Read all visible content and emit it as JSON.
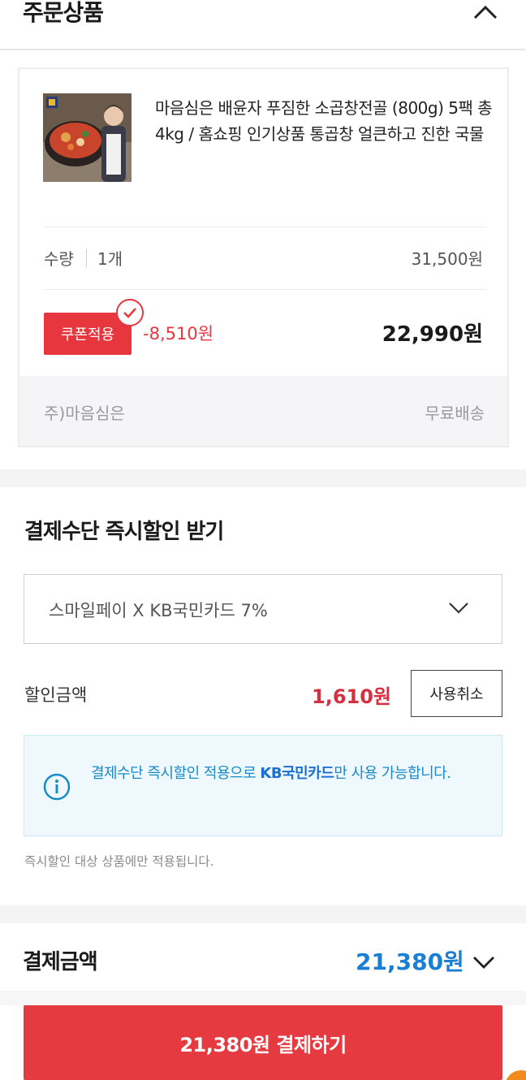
{
  "order_section": {
    "title": "주문상품",
    "product_name": "마음심은 배윤자 푸짐한 소곱창전골 (800g) 5팩 총 4kg / 홈쇼핑 인기상품 통곱창 얼큰하고 진한 국물",
    "quantity_label": "수량",
    "quantity_value": "1개",
    "original_price": "31,500원",
    "coupon_button": "쿠폰적용",
    "coupon_discount": "-8,510원",
    "final_price": "22,990원",
    "seller": "주)마음심은",
    "shipping": "무료배송"
  },
  "instant_discount": {
    "title": "결제수단 즉시할인 받기",
    "selected_option": "스마일페이 X KB국민카드 7%",
    "discount_label": "할인금액",
    "discount_amount": "1,610원",
    "cancel_button": "사용취소",
    "info_prefix": "결제수단 즉시할인 적용으로 ",
    "info_highlight": "KB국민카드",
    "info_suffix": "만 사용 가능합니다.",
    "notice": "즉시할인 대상 상품에만 적용됩니다."
  },
  "payment": {
    "title": "결제금액",
    "amount": "21,380원",
    "pay_button": "21,380원 결제하기"
  },
  "colors": {
    "accent_red": "#e8363e",
    "accent_blue": "#1a7fd4",
    "info_bg": "#eef8fd"
  },
  "icons": [
    "chevron-up-icon",
    "check-circle-icon",
    "chevron-down-icon",
    "info-icon"
  ]
}
